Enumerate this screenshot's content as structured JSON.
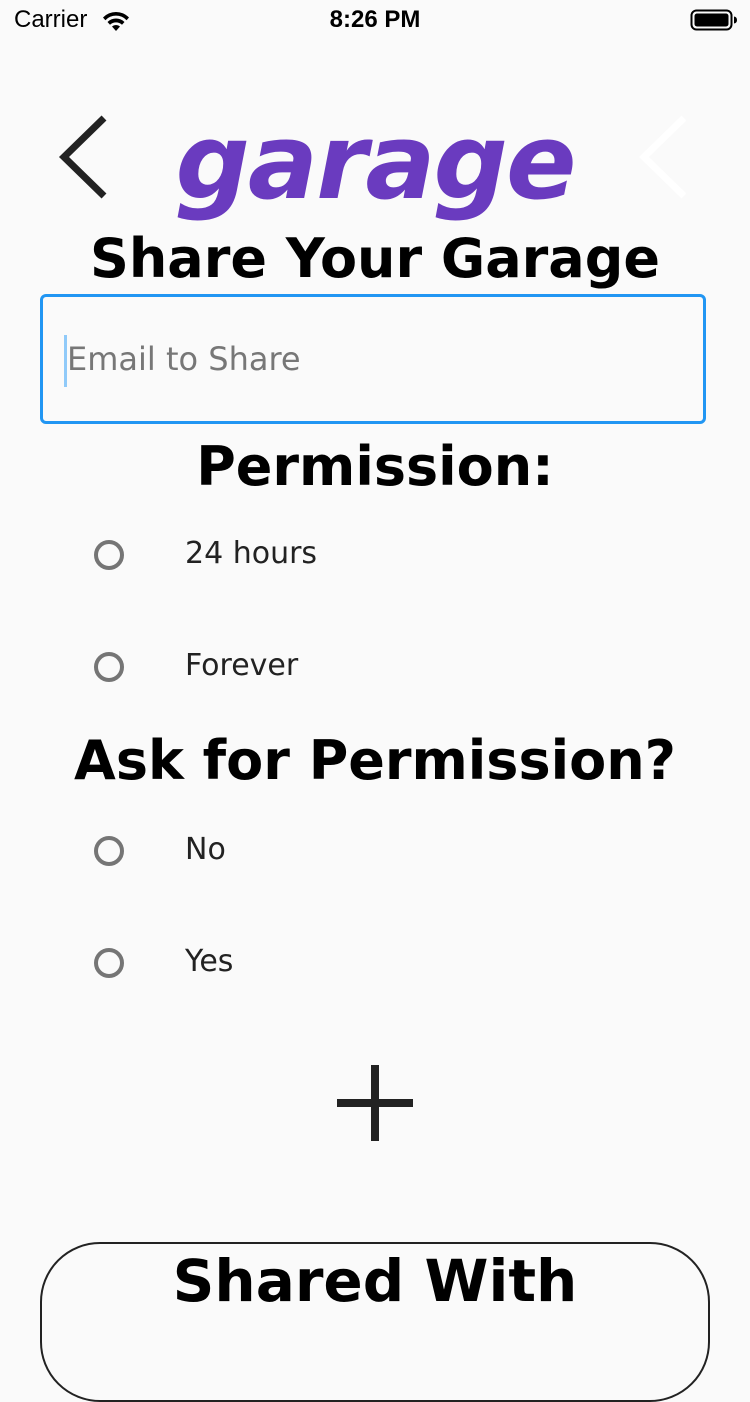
{
  "status_bar": {
    "carrier": "Carrier",
    "time": "8:26 PM",
    "wifi_icon": "wifi-icon",
    "battery_icon": "battery-icon"
  },
  "header": {
    "logo": "garage",
    "logo_color": "#6a3bbf",
    "back_icon": "chevron-left-icon"
  },
  "page": {
    "title": "Share Your Garage"
  },
  "email": {
    "placeholder": "Email to Share",
    "value": "",
    "focus_color": "#2196f3"
  },
  "permission": {
    "title": "Permission:",
    "options": [
      {
        "label": "24 hours",
        "selected": false
      },
      {
        "label": "Forever",
        "selected": false
      }
    ]
  },
  "ask_permission": {
    "title": "Ask for Permission?",
    "options": [
      {
        "label": "No",
        "selected": false
      },
      {
        "label": "Yes",
        "selected": false
      }
    ]
  },
  "actions": {
    "add_icon": "plus-icon"
  },
  "shared_with": {
    "title": "Shared With"
  }
}
